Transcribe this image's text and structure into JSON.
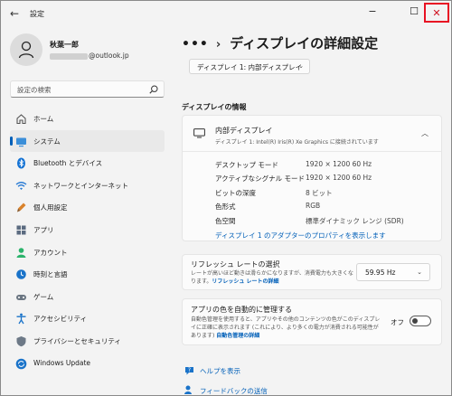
{
  "window": {
    "title": "設定",
    "back_icon": "←",
    "minimize_icon": "−",
    "maximize_icon": "☐",
    "close_icon": "✕"
  },
  "profile": {
    "name": "秋葉一郎",
    "email_visible": "@outlook.jp"
  },
  "search": {
    "placeholder": "設定の検索"
  },
  "nav": [
    {
      "label": "ホーム",
      "icon": "home-icon",
      "active": false
    },
    {
      "label": "システム",
      "icon": "system-icon",
      "active": true
    },
    {
      "label": "Bluetooth とデバイス",
      "icon": "bluetooth-icon",
      "active": false
    },
    {
      "label": "ネットワークとインターネット",
      "icon": "network-icon",
      "active": false
    },
    {
      "label": "個人用設定",
      "icon": "personalization-icon",
      "active": false
    },
    {
      "label": "アプリ",
      "icon": "apps-icon",
      "active": false
    },
    {
      "label": "アカウント",
      "icon": "account-icon",
      "active": false
    },
    {
      "label": "時刻と言語",
      "icon": "time-language-icon",
      "active": false
    },
    {
      "label": "ゲーム",
      "icon": "gaming-icon",
      "active": false
    },
    {
      "label": "アクセシビリティ",
      "icon": "accessibility-icon",
      "active": false
    },
    {
      "label": "プライバシーとセキュリティ",
      "icon": "privacy-shield-icon",
      "active": false
    },
    {
      "label": "Windows Update",
      "icon": "windows-update-icon",
      "active": false
    }
  ],
  "breadcrumb": {
    "dots": "•••",
    "separator": "›",
    "title": "ディスプレイの詳細設定"
  },
  "display_select": {
    "value": "ディスプレイ 1: 内部ディスプレイ",
    "chevron": "⌄"
  },
  "info_section": {
    "title": "ディスプレイの情報",
    "card_title": "内部ディスプレイ",
    "card_subtitle": "ディスプレイ 1: Intel(R) Iris(R) Xe Graphics に接続されています",
    "chevron": "︿",
    "rows": [
      {
        "label": "デスクトップ モード",
        "value": "1920 × 1200 60 Hz"
      },
      {
        "label": "アクティブなシグナル モード",
        "value": "1920 × 1200 60 Hz"
      },
      {
        "label": "ビットの深度",
        "value": "8 ビット"
      },
      {
        "label": "色形式",
        "value": "RGB"
      },
      {
        "label": "色空間",
        "value": "標準ダイナミック レンジ (SDR)"
      }
    ],
    "adapter_link": "ディスプレイ 1 のアダプターのプロパティを表示します"
  },
  "refresh": {
    "title": "リフレッシュ レートの選択",
    "desc": "レートが高いほど動きは滑らかになりますが、消費電力も大きくなります。",
    "link": "リフレッシュ レートの詳細",
    "value": "59.95 Hz",
    "chevron": "⌄"
  },
  "auto_color": {
    "title": "アプリの色を自動的に管理する",
    "desc": "自動色管理を使用すると、アプリやその他のコンテンツの色がこのディスプレイに正確に表示されます (これにより、より多くの電力が消費される可能性があります)",
    "link": "自動色管理の詳細",
    "toggle_label": "オフ",
    "toggle_on": false
  },
  "footer": {
    "help": "ヘルプを表示",
    "feedback": "フィードバックの送信"
  },
  "colors": {
    "accent": "#005fb8",
    "close_highlight": "#e81123"
  }
}
